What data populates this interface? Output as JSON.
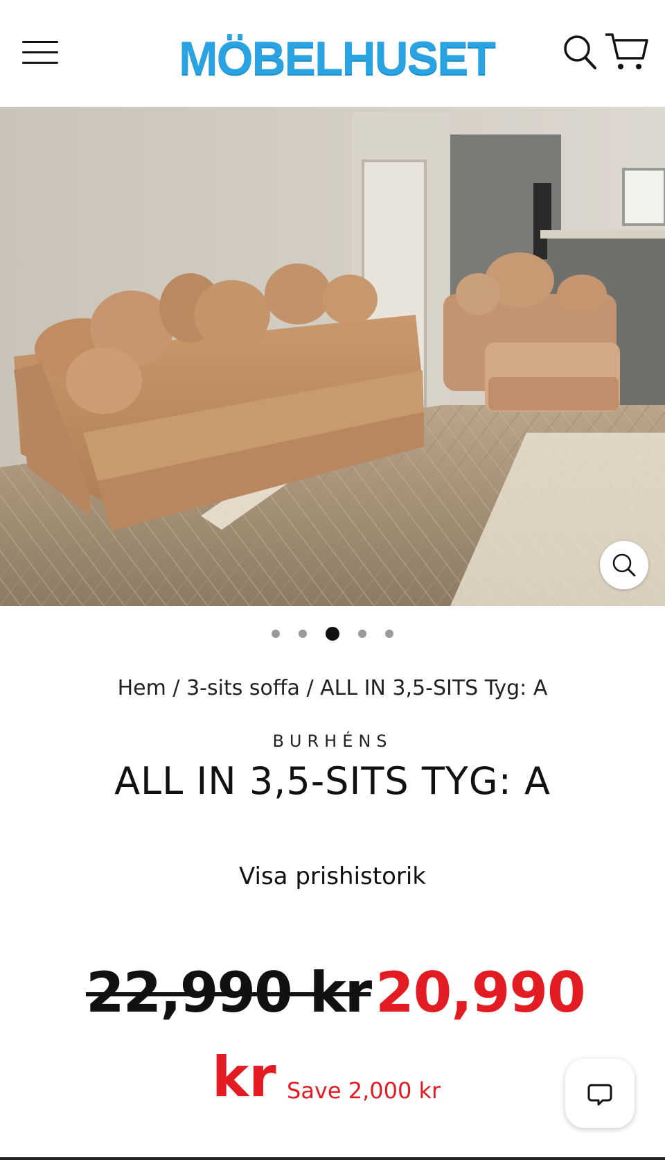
{
  "header": {
    "logo_text": "MÖBELHUSET",
    "icons": [
      "hamburger-menu-icon",
      "search-icon",
      "cart-icon"
    ],
    "brand_color": "#2aa3e3"
  },
  "gallery": {
    "image_description_alt": "Sofa",
    "slide_count": 5,
    "active_slide": 3
  },
  "breadcrumb": {
    "home": "Hem",
    "separator": " / ",
    "category": "3-sits soffa",
    "current": "ALL IN 3,5-SITS Tyg: A"
  },
  "product": {
    "vendor": "BURHÉNS",
    "title": "ALL IN 3,5-SITS TYG: A",
    "price_history_link": "Visa prishistorik",
    "compare_price": "22,990 kr",
    "sale_price_amount": "20,990",
    "sale_price_currency": "kr",
    "save_text": "Save 2,000 kr",
    "sale_color": "#e31b23"
  }
}
